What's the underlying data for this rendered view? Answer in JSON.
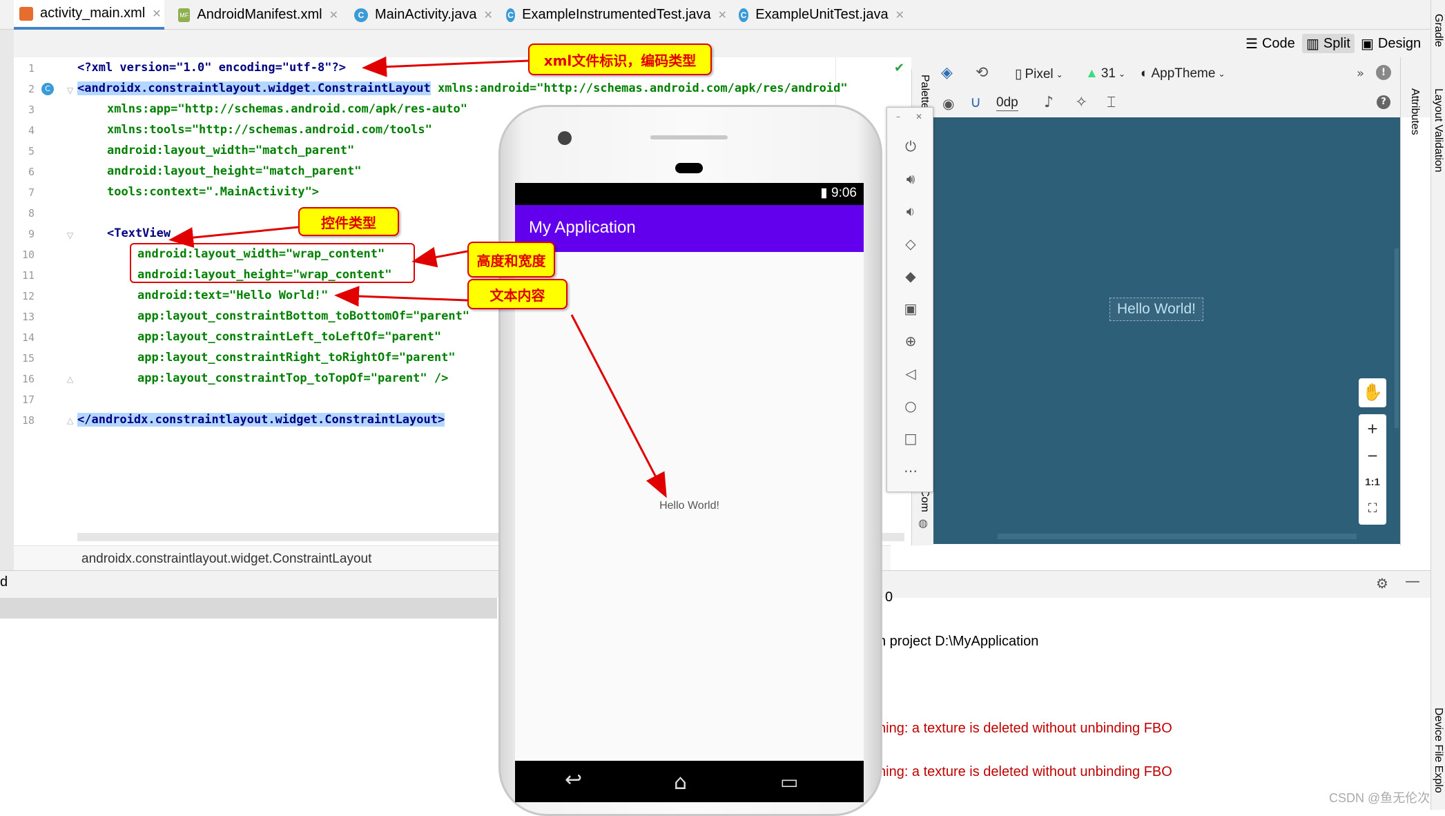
{
  "tabs": [
    {
      "label": "activity_main.xml",
      "icon": "xml-file-icon"
    },
    {
      "label": "AndroidManifest.xml",
      "icon": "manifest-file-icon",
      "icon_text": "MF"
    },
    {
      "label": "MainActivity.java",
      "icon": "class-icon",
      "icon_text": "C"
    },
    {
      "label": "ExampleInstrumentedTest.java",
      "icon": "class-icon",
      "icon_text": "C"
    },
    {
      "label": "ExampleUnitTest.java",
      "icon": "class-icon",
      "icon_text": "C"
    }
  ],
  "right_strip": {
    "gradle": "Gradle",
    "layout_validation": "Layout Validation",
    "device_file": "Device File Explo"
  },
  "view_modes": {
    "code": "Code",
    "split": "Split",
    "design": "Design"
  },
  "line_numbers": [
    "1",
    "2",
    "3",
    "4",
    "5",
    "6",
    "7",
    "8",
    "9",
    "10",
    "11",
    "12",
    "13",
    "14",
    "15",
    "16",
    "17",
    "18"
  ],
  "code": {
    "l1": "<?xml version=\"1.0\" encoding=\"utf-8\"?>",
    "l2_tag": "<androidx.constraintlayout.widget.ConstraintLayout",
    "l2_attr": " xmlns:android=\"http://schemas.android.com/apk/res/android\"",
    "l3": "xmlns:app=\"http://schemas.android.com/apk/res-auto\"",
    "l4": "xmlns:tools=\"http://schemas.android.com/tools\"",
    "l5": "android:layout_width=\"match_parent\"",
    "l6": "android:layout_height=\"match_parent\"",
    "l7": "tools:context=\".MainActivity\">",
    "l9": "<TextView",
    "l10": "android:layout_width=\"wrap_content\"",
    "l11": "android:layout_height=\"wrap_content\"",
    "l12": "android:text=\"Hello World!\"",
    "l13": "app:layout_constraintBottom_toBottomOf=\"parent\"",
    "l14": "app:layout_constraintLeft_toLeftOf=\"parent\"",
    "l15": "app:layout_constraintRight_toRightOf=\"parent\"",
    "l16": "app:layout_constraintTop_toTopOf=\"parent\" />",
    "l18": "</androidx.constraintlayout.widget.ConstraintLayout>"
  },
  "breadcrumb": "androidx.constraintlayout.widget.ConstraintLayout",
  "design_toolbar": {
    "device": "Pixel",
    "api": "31",
    "theme": "AppTheme",
    "margin": "0dp",
    "palette": "Palette",
    "attributes": "Attributes",
    "component_tree": "Com"
  },
  "design_preview": {
    "text": "Hello World!"
  },
  "zoom": {
    "zoom_in": "+",
    "zoom_out": "−",
    "one_to_one": "1:1"
  },
  "emulator": {
    "status_time": "9:06",
    "app_title": "My Application",
    "content_text": "Hello World!"
  },
  "callouts": {
    "xml": "xml文件标识，编码类型",
    "control": "控件类型",
    "size": "高度和宽度",
    "text": "文本内容"
  },
  "console": {
    "line1": "0",
    "line2": "n project D:\\MyApplication",
    "warn1": "ning: a texture is deleted without unbinding FBO",
    "warn2": "ning: a texture is deleted without unbinding FBO",
    "left_frag": "d"
  },
  "watermark": "CSDN @鱼无伦次",
  "colors": {
    "app_bar": "#6200ee",
    "design_bg": "#2e5f78",
    "callout_fill": "#ffff00",
    "callout_text": "#e00000",
    "warning": "#c00000"
  }
}
